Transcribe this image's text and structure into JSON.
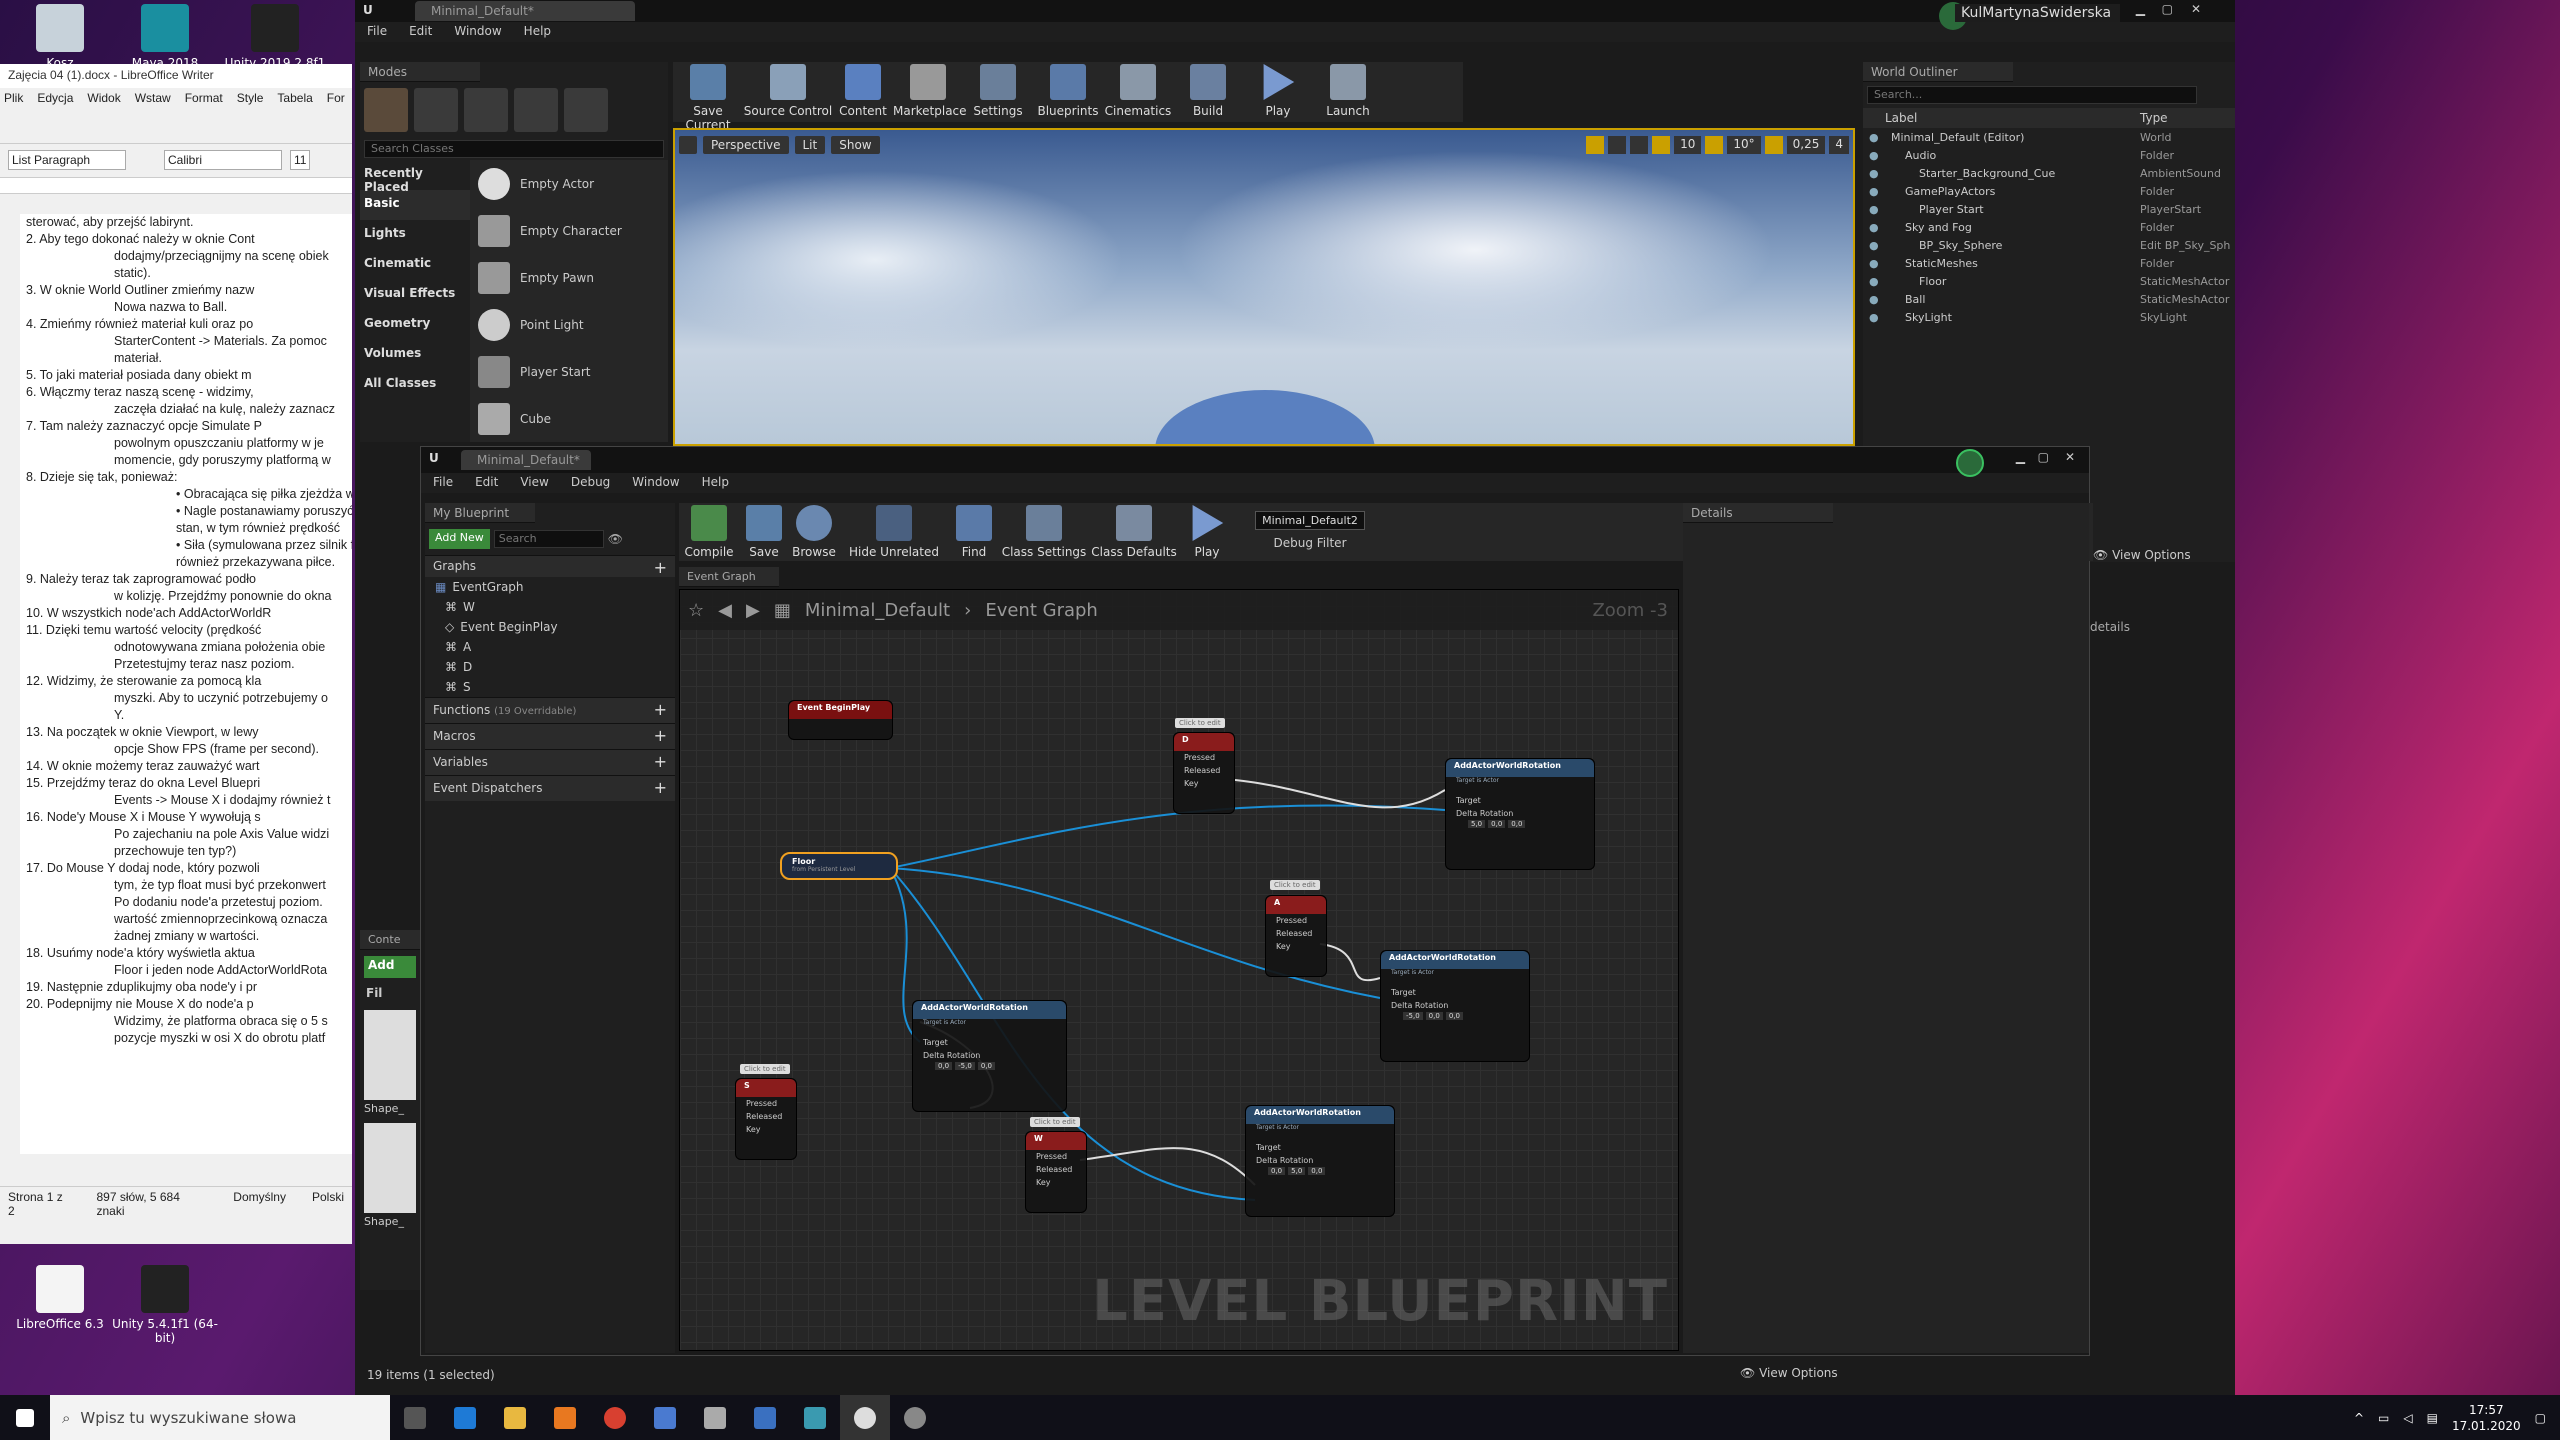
{
  "desktop": {
    "icons": [
      {
        "label": "Kosz"
      },
      {
        "label": "Maya 2018"
      },
      {
        "label": "Unity 2019.2.8f1"
      },
      {
        "label": "LibreOffice 6.3"
      },
      {
        "label": "Unity 5.4.1f1 (64-bit)"
      }
    ]
  },
  "writer": {
    "title": "Zajęcia 04 (1).docx - LibreOffice Writer",
    "menu": [
      "Plik",
      "Edycja",
      "Widok",
      "Wstaw",
      "Format",
      "Style",
      "Tabela",
      "For"
    ],
    "style": "List Paragraph",
    "font": "Calibri",
    "size": "11",
    "lines": [
      {
        "t": "sterować, aby przejść labirynt.",
        "c": ""
      },
      {
        "t": "2.   Aby tego dokonać należy w oknie Cont",
        "c": ""
      },
      {
        "t": "dodajmy/przeciągnijmy na scenę obiek",
        "c": "s"
      },
      {
        "t": "static).",
        "c": "s"
      },
      {
        "t": "3.   W oknie World Outliner zmieńmy nazw",
        "c": ""
      },
      {
        "t": "Nowa nazwa to Ball.",
        "c": "s"
      },
      {
        "t": "4.   Zmieńmy również materiał kuli oraz po",
        "c": ""
      },
      {
        "t": "StarterContent -> Materials. Za pomoc",
        "c": "s"
      },
      {
        "t": "materiał.",
        "c": "s"
      },
      {
        "t": "5.   To jaki materiał posiada dany obiekt m",
        "c": ""
      },
      {
        "t": "6.   Włączmy teraz naszą scenę - widzimy,",
        "c": ""
      },
      {
        "t": "zaczęła działać na kulę, należy zaznacz",
        "c": "s"
      },
      {
        "t": "7.   Tam należy zaznaczyć opcje Simulate P",
        "c": ""
      },
      {
        "t": "powolnym opuszczaniu platformy w je",
        "c": "s"
      },
      {
        "t": "momencie, gdy poruszymy platformą w",
        "c": "s"
      },
      {
        "t": "8.   Dzieje się tak, ponieważ:",
        "c": ""
      },
      {
        "t": "•   Obracająca się piłka zjeżdża w",
        "c": "b"
      },
      {
        "t": "•   Nagle postanawiamy poruszyć",
        "c": "b"
      },
      {
        "t": "stan, w tym również prędkość",
        "c": "b"
      },
      {
        "t": "•   Siła (symulowana przez silnik f",
        "c": "b"
      },
      {
        "t": "również przekazywana piłce.",
        "c": "b"
      },
      {
        "t": "9.   Należy teraz tak zaprogramować podło",
        "c": ""
      },
      {
        "t": "w kolizję. Przejdźmy ponownie do okna",
        "c": "s"
      },
      {
        "t": "10.  W wszystkich node'ach AddActorWorldR",
        "c": ""
      },
      {
        "t": "11.  Dzięki temu wartość velocity (prędkość",
        "c": ""
      },
      {
        "t": "odnotowywana zmiana położenia obie",
        "c": "s"
      },
      {
        "t": "Przetestujmy teraz nasz poziom.",
        "c": "s"
      },
      {
        "t": "12.  Widzimy, że sterowanie za pomocą kla",
        "c": ""
      },
      {
        "t": "myszki. Aby to uczynić potrzebujemy o",
        "c": "s"
      },
      {
        "t": "Y.",
        "c": "s"
      },
      {
        "t": "13.  Na początek w oknie Viewport, w lewy",
        "c": ""
      },
      {
        "t": "opcje Show FPS (frame per second).",
        "c": "s"
      },
      {
        "t": "14.  W oknie możemy teraz zauważyć wart",
        "c": ""
      },
      {
        "t": "15.  Przejdźmy teraz do okna Level Bluepri",
        "c": ""
      },
      {
        "t": "Events -> Mouse X i dodajmy również t",
        "c": "s"
      },
      {
        "t": "16.  Node'y Mouse X i Mouse Y wywołują s",
        "c": ""
      },
      {
        "t": "Po zajechaniu na pole Axis Value widzi",
        "c": "s"
      },
      {
        "t": "przechowuje ten typ?)",
        "c": "s"
      },
      {
        "t": "17.  Do Mouse Y dodaj node, który pozwoli",
        "c": ""
      },
      {
        "t": "tym, że typ float musi być przekonwert",
        "c": "s"
      },
      {
        "t": "Po dodaniu node'a przetestuj poziom.",
        "c": "s"
      },
      {
        "t": "wartość zmiennoprzecinkową oznacza",
        "c": "s"
      },
      {
        "t": "żadnej zmiany w wartości.",
        "c": "s"
      },
      {
        "t": "18.  Usuńmy node'a który wyświetla aktua",
        "c": ""
      },
      {
        "t": "Floor i jeden node AddActorWorldRota",
        "c": "s"
      },
      {
        "t": "19.  Następnie zduplikujmy oba node'y i pr",
        "c": ""
      },
      {
        "t": "20.  Podepnijmy nie Mouse X do node'a p",
        "c": ""
      },
      {
        "t": "Widzimy, że platforma obraca się o 5 s",
        "c": "s"
      },
      {
        "t": "pozycje myszki w osi X do obrotu platf",
        "c": "s"
      }
    ],
    "status": [
      "Strona 1 z 2",
      "897 słów, 5 684 znaki",
      "Domyślny",
      "Polski"
    ]
  },
  "ue": {
    "tab": "Minimal_Default*",
    "user": "KulMartynaSwiderska",
    "menu": [
      "File",
      "Edit",
      "Window",
      "Help"
    ],
    "modes": {
      "title": "Modes",
      "search": "Search Classes",
      "categories": [
        "Recently Placed",
        "Basic",
        "Lights",
        "Cinematic",
        "Visual Effects",
        "Geometry",
        "Volumes",
        "All Classes"
      ],
      "items": [
        "Empty Actor",
        "Empty Character",
        "Empty Pawn",
        "Point Light",
        "Player Start",
        "Cube"
      ]
    },
    "toolbar": [
      "Save Current",
      "Source Control",
      "Content",
      "Marketplace",
      "Settings",
      "Blueprints",
      "Cinematics",
      "Build",
      "Play",
      "Launch"
    ],
    "viewport": {
      "perspective": "Perspective",
      "lit": "Lit",
      "show": "Show",
      "grid": "10",
      "angle": "10°",
      "scale": "0,25",
      "cam": "4"
    },
    "outliner": {
      "title": "World Outliner",
      "search": "Search...",
      "col_label": "Label",
      "col_type": "Type",
      "rows": [
        {
          "label": "Minimal_Default (Editor)",
          "type": "World",
          "indent": 0
        },
        {
          "label": "Audio",
          "type": "Folder",
          "indent": 1
        },
        {
          "label": "Starter_Background_Cue",
          "type": "AmbientSound",
          "indent": 2
        },
        {
          "label": "GamePlayActors",
          "type": "Folder",
          "indent": 1
        },
        {
          "label": "Player Start",
          "type": "PlayerStart",
          "indent": 2
        },
        {
          "label": "Sky and Fog",
          "type": "Folder",
          "indent": 1
        },
        {
          "label": "BP_Sky_Sphere",
          "type": "Edit BP_Sky_Sph",
          "indent": 2
        },
        {
          "label": "StaticMeshes",
          "type": "Folder",
          "indent": 1
        },
        {
          "label": "Floor",
          "type": "StaticMeshActor",
          "indent": 2
        },
        {
          "label": "Ball",
          "type": "StaticMeshActor",
          "indent": 1
        },
        {
          "label": "SkyLight",
          "type": "SkyLight",
          "indent": 1
        }
      ],
      "view_options": "View Options",
      "details": "details"
    },
    "content": {
      "tab": "Conte",
      "add": "Add",
      "filter": "Fil",
      "items": [
        "Shape_",
        "Shape_"
      ]
    },
    "status": "19 items (1 selected)",
    "view_options2": "View Options"
  },
  "bp": {
    "tab": "Minimal_Default*",
    "menu": [
      "File",
      "Edit",
      "View",
      "Debug",
      "Window",
      "Help"
    ],
    "toolbar": [
      "Compile",
      "Save",
      "Browse",
      "Hide Unrelated",
      "Find",
      "Class Settings",
      "Class Defaults",
      "Play"
    ],
    "debug_select": "Minimal_Default2",
    "debug_filter": "Debug Filter",
    "my_blueprint": "My Blueprint",
    "add_new": "Add New",
    "search": "Search",
    "graphs": "Graphs",
    "graph_items": [
      "EventGraph",
      "W",
      "Event BeginPlay",
      "A",
      "D",
      "S"
    ],
    "functions": "Functions",
    "functions_count": "(19 Overridable)",
    "macros": "Macros",
    "variables": "Variables",
    "dispatchers": "Event Dispatchers",
    "graph_tab": "Event Graph",
    "breadcrumb": [
      "Minimal_Default",
      "Event Graph"
    ],
    "zoom": "Zoom -3",
    "watermark": "LEVEL BLUEPRINT",
    "details": "Details",
    "nodes": {
      "begin": "Event BeginPlay",
      "floor": "Floor",
      "floor_sub": "from Persistent Level",
      "click": "Click to edit",
      "pressed": "Pressed",
      "released": "Released",
      "key": "Key",
      "keys": [
        "D",
        "A",
        "S",
        "W"
      ],
      "add": "AddActorWorldRotation",
      "target_is": "Target is Actor",
      "target": "Target",
      "delta": "Delta Rotation",
      "rot": [
        [
          "5,0",
          "0,0",
          "0,0"
        ],
        [
          "-5,0",
          "0,0",
          "0,0"
        ],
        [
          "0,0",
          "-5,0",
          "0,0"
        ],
        [
          "0,0",
          "5,0",
          "0,0"
        ]
      ]
    }
  },
  "taskbar": {
    "search": "Wpisz tu wyszukiwane słowa",
    "time": "17:57",
    "date": "17.01.2020"
  },
  "colors": {
    "exec": "#ffffff",
    "object_pin": "#0fa0e6",
    "wire_blue": "#1a8fd6",
    "key_header": "#8a1c1c",
    "func_header": "#2a4a6a",
    "event_header": "#7a1010",
    "accent": "#f0a020"
  }
}
